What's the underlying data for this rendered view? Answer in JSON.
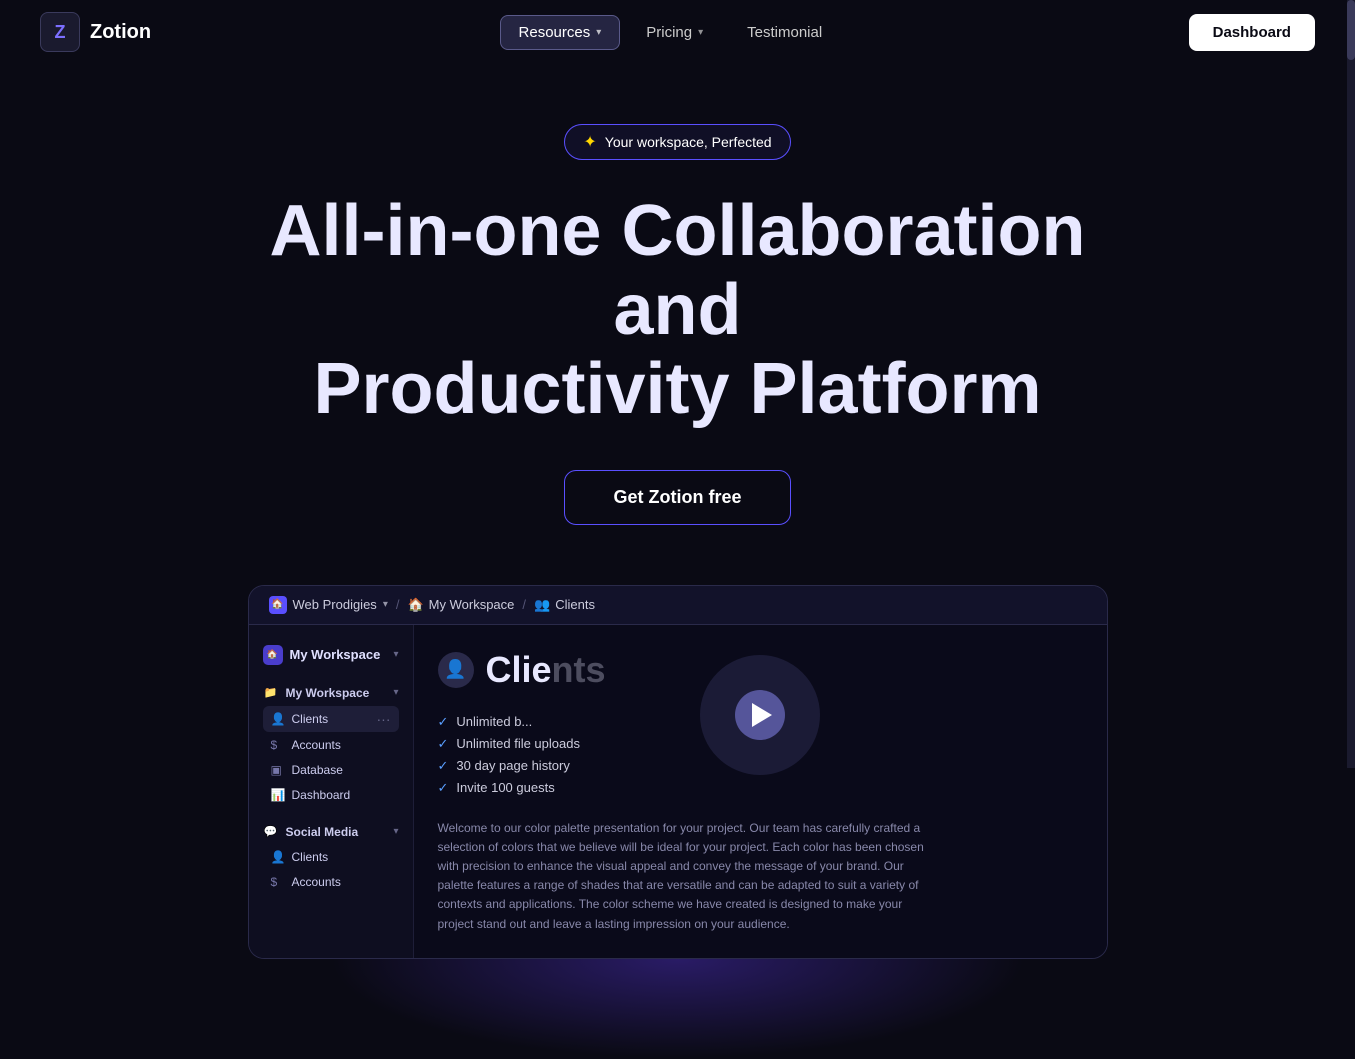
{
  "logo": {
    "icon_text": "Z",
    "name": "Zotion"
  },
  "navbar": {
    "resources_label": "Resources",
    "pricing_label": "Pricing",
    "testimonial_label": "Testimonial",
    "dashboard_label": "Dashboard"
  },
  "hero": {
    "badge_star": "✦",
    "badge_text": "Your workspace, Perfected",
    "title_line1": "All-in-one Collaboration and",
    "title_line2": "Productivity Platform",
    "cta_label": "Get Zotion free"
  },
  "demo": {
    "workspace_name": "Web Prodigies",
    "breadcrumb": {
      "workspace": "My Workspace",
      "page": "Clients"
    },
    "sidebar": {
      "workspace_label": "My Workspace",
      "sections": [
        {
          "label": "My Workspace",
          "items": [
            {
              "name": "Clients",
              "icon": "👤"
            },
            {
              "name": "Accounts",
              "icon": "$"
            },
            {
              "name": "Database",
              "icon": "▣"
            },
            {
              "name": "Dashboard",
              "icon": "📊"
            }
          ]
        },
        {
          "label": "Social Media",
          "items": [
            {
              "name": "Clients",
              "icon": "👤"
            },
            {
              "name": "Accounts",
              "icon": "$"
            }
          ]
        }
      ]
    },
    "content": {
      "page_title": "Clie",
      "features": [
        "Unlimited b...",
        "Unlimited file uploads",
        "30 day page history",
        "Invite 100 guests"
      ],
      "description": "Welcome to our color palette presentation for your project. Our team has carefully crafted a selection of colors that we believe will be ideal for your project. Each color has been chosen with precision to enhance the visual appeal and convey the message of your brand. Our palette features a range of shades that are versatile and can be adapted to suit a variety of contexts and applications. The color scheme we have created is designed to make your project stand out and leave a lasting impression on your audience."
    }
  }
}
